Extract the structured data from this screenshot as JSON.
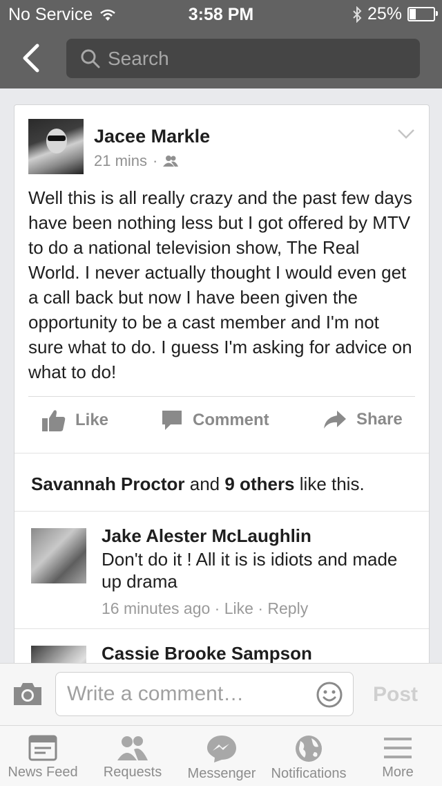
{
  "status_bar": {
    "carrier": "No Service",
    "time": "3:58 PM",
    "battery": "25%",
    "battery_level": 0.25,
    "icons": [
      "wifi-icon",
      "bluetooth-icon",
      "battery-icon"
    ]
  },
  "nav": {
    "search_placeholder": "Search",
    "icons": [
      "back-chevron-icon",
      "search-icon"
    ]
  },
  "post": {
    "author": "Jacee Markle",
    "time": "21 mins",
    "separator": "·",
    "text": "Well this is all really crazy and the past few days have been nothing less but I got offered by MTV to do a national television show, The Real World. I never actually thought I would even get a call back but now I have been given the opportunity to be a cast member and I'm not sure what to do. I guess I'm asking for advice on what to do!",
    "actions": {
      "like": "Like",
      "comment": "Comment",
      "share": "Share"
    },
    "likes": {
      "name": "Savannah Proctor",
      "and": "and",
      "others": "9 others",
      "suffix": "like this."
    }
  },
  "comments": [
    {
      "name": "Jake Alester McLaughlin",
      "text": "Don't do it ! All it is is idiots and made up drama",
      "time": "16 minutes ago",
      "like": "Like",
      "reply": "Reply",
      "sep": "·"
    },
    {
      "name": "Cassie Brooke Sampson"
    }
  ],
  "composer": {
    "placeholder": "Write a comment…",
    "post_label": "Post"
  },
  "tabs": [
    {
      "label": "News Feed",
      "icon": "news-feed-icon"
    },
    {
      "label": "Requests",
      "icon": "friend-requests-icon"
    },
    {
      "label": "Messenger",
      "icon": "messenger-icon"
    },
    {
      "label": "Notifications",
      "icon": "globe-notifications-icon"
    },
    {
      "label": "More",
      "icon": "menu-lines-icon"
    }
  ],
  "colors": {
    "bar_background": "#626262",
    "search_background": "#454545",
    "page_background": "#e9eaed",
    "muted_text": "#8a8a8a"
  }
}
